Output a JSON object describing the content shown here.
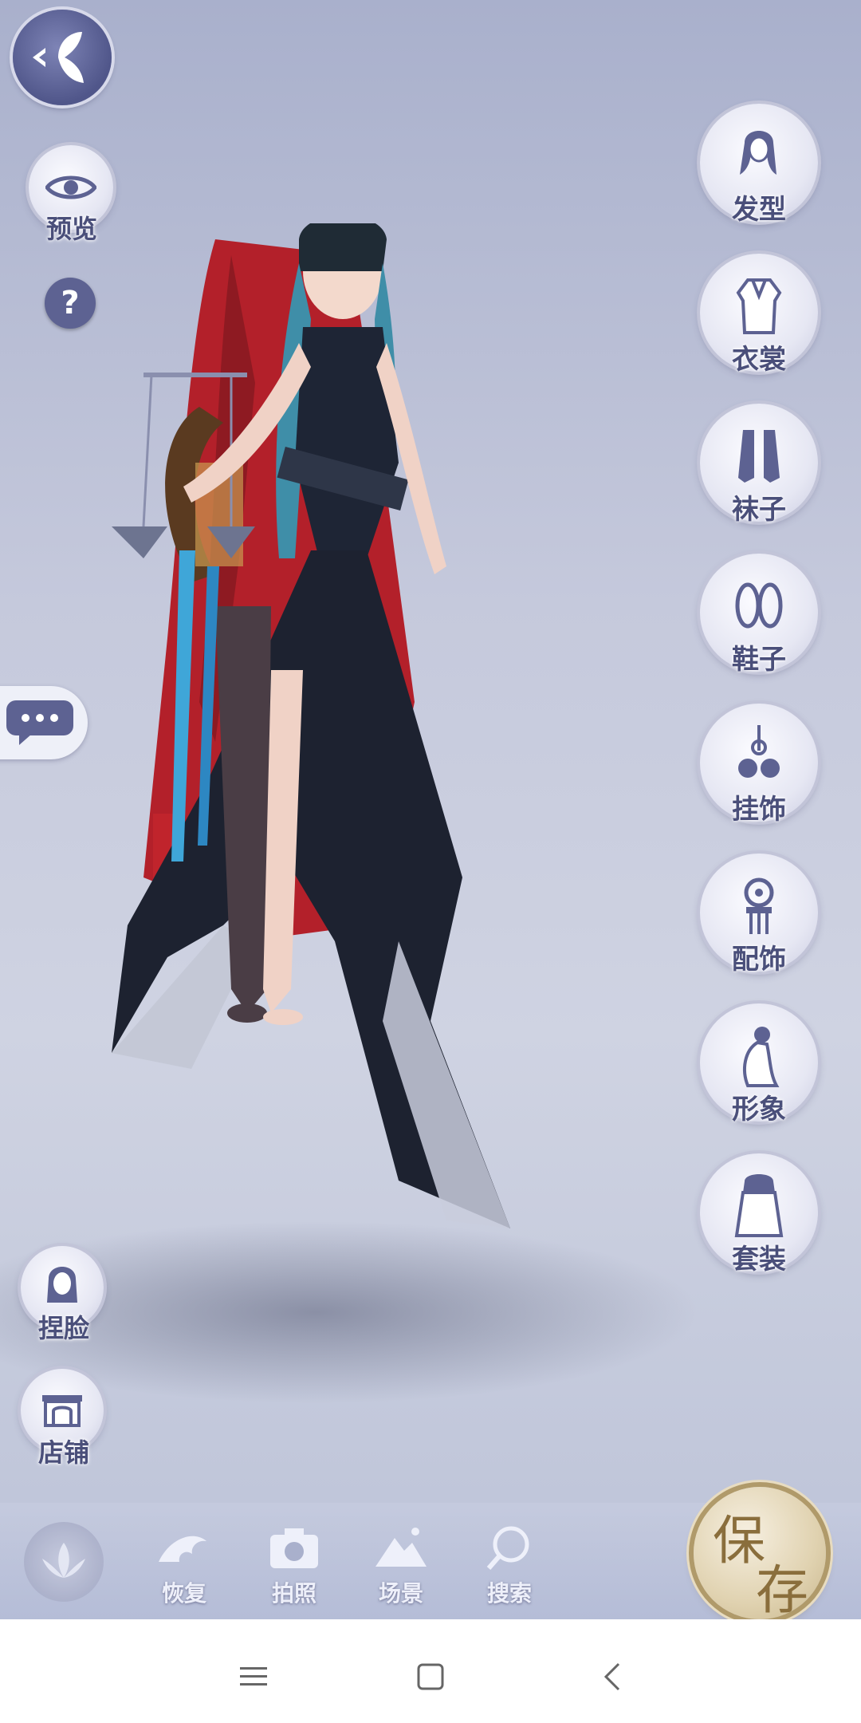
{
  "right_menu": [
    {
      "id": "hair",
      "label": "发型",
      "icon": "hairstyle-icon"
    },
    {
      "id": "clothes",
      "label": "衣裳",
      "icon": "dress-icon"
    },
    {
      "id": "socks",
      "label": "袜子",
      "icon": "socks-icon"
    },
    {
      "id": "shoes",
      "label": "鞋子",
      "icon": "shoes-icon"
    },
    {
      "id": "hanging",
      "label": "挂饰",
      "icon": "bells-icon"
    },
    {
      "id": "accessory",
      "label": "配饰",
      "icon": "hairpin-icon"
    },
    {
      "id": "image",
      "label": "形象",
      "icon": "figure-icon"
    },
    {
      "id": "outfit",
      "label": "套装",
      "icon": "outfit-icon"
    }
  ],
  "left": {
    "preview_label": "预览",
    "help_symbol": "?",
    "face_label": "捏脸",
    "shop_label": "店铺"
  },
  "bottom": {
    "restore_label": "恢复",
    "photo_label": "拍照",
    "scene_label": "场景",
    "search_label": "搜索",
    "save_char1": "保",
    "save_char2": "存"
  },
  "colors": {
    "accent": "#4a4f7a",
    "background_top": "#a9b0cc",
    "save_gold": "#8a6e3c"
  }
}
